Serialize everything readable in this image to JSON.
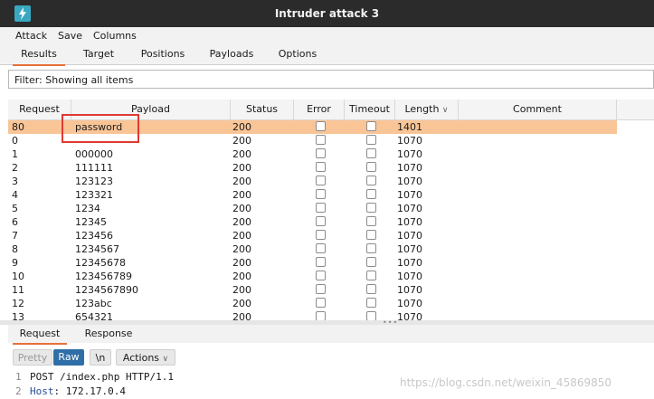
{
  "window": {
    "title": "Intruder attack 3"
  },
  "menu": [
    "Attack",
    "Save",
    "Columns"
  ],
  "tabs": [
    {
      "label": "Results",
      "active": true
    },
    {
      "label": "Target",
      "active": false
    },
    {
      "label": "Positions",
      "active": false
    },
    {
      "label": "Payloads",
      "active": false
    },
    {
      "label": "Options",
      "active": false
    }
  ],
  "filter": {
    "text": "Filter: Showing all items"
  },
  "table": {
    "columns": [
      "Request",
      "Payload",
      "Status",
      "Error",
      "Timeout",
      "Length",
      "Comment"
    ],
    "sort_column": "Length",
    "rows": [
      {
        "request": "80",
        "payload": "password",
        "status": "200",
        "length": "1401",
        "selected": true
      },
      {
        "request": "0",
        "payload": "",
        "status": "200",
        "length": "1070"
      },
      {
        "request": "1",
        "payload": "000000",
        "status": "200",
        "length": "1070"
      },
      {
        "request": "2",
        "payload": "111111",
        "status": "200",
        "length": "1070"
      },
      {
        "request": "3",
        "payload": "123123",
        "status": "200",
        "length": "1070"
      },
      {
        "request": "4",
        "payload": "123321",
        "status": "200",
        "length": "1070"
      },
      {
        "request": "5",
        "payload": "1234",
        "status": "200",
        "length": "1070"
      },
      {
        "request": "6",
        "payload": "12345",
        "status": "200",
        "length": "1070"
      },
      {
        "request": "7",
        "payload": "123456",
        "status": "200",
        "length": "1070"
      },
      {
        "request": "8",
        "payload": "1234567",
        "status": "200",
        "length": "1070"
      },
      {
        "request": "9",
        "payload": "12345678",
        "status": "200",
        "length": "1070"
      },
      {
        "request": "10",
        "payload": "123456789",
        "status": "200",
        "length": "1070"
      },
      {
        "request": "11",
        "payload": "1234567890",
        "status": "200",
        "length": "1070"
      },
      {
        "request": "12",
        "payload": "123abc",
        "status": "200",
        "length": "1070"
      },
      {
        "request": "13",
        "payload": "654321",
        "status": "200",
        "length": "1070"
      }
    ]
  },
  "lower": {
    "tabs": [
      {
        "label": "Request",
        "active": true
      },
      {
        "label": "Response",
        "active": false
      }
    ],
    "buttons": {
      "pretty": "Pretty",
      "raw": "Raw",
      "newline": "\\n",
      "actions": "Actions"
    },
    "lines": [
      {
        "num": "1",
        "parts": [
          "POST",
          " /index.php HTTP/1.1"
        ]
      },
      {
        "num": "2",
        "parts": [
          "Host",
          ": 172.17.0.4"
        ]
      }
    ]
  },
  "watermark": "https://blog.csdn.net/weixin_45869850",
  "colors": {
    "accent": "#e8703a",
    "selected_row": "#f9c597",
    "highlight_box": "#e03a33",
    "raw_button": "#2f6fa7"
  }
}
